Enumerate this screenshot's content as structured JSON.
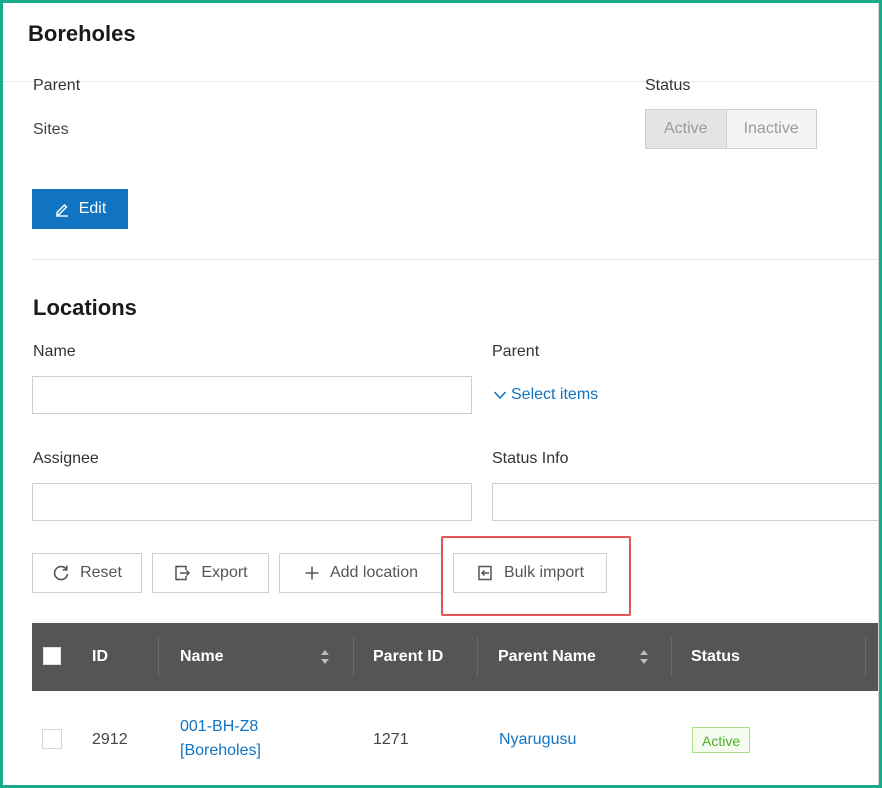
{
  "header": {
    "title": "Boreholes"
  },
  "details": {
    "parent_label": "Parent",
    "parent_value": "Sites",
    "status_label": "Status",
    "status_options": [
      "Active",
      "Inactive"
    ],
    "status_selected": "Active",
    "edit_label": "Edit"
  },
  "locations": {
    "title": "Locations",
    "filters": {
      "name_label": "Name",
      "name_value": "",
      "parent_label": "Parent",
      "parent_select_label": "Select items",
      "assignee_label": "Assignee",
      "assignee_value": "",
      "status_info_label": "Status Info",
      "status_info_value": ""
    },
    "toolbar": {
      "reset_label": "Reset",
      "export_label": "Export",
      "add_label": "Add location",
      "bulk_import_label": "Bulk import"
    },
    "table": {
      "columns": [
        "ID",
        "Name",
        "Parent ID",
        "Parent Name",
        "Status"
      ],
      "rows": [
        {
          "id": "2912",
          "name_line1": "001-BH-Z8",
          "name_line2": "[Boreholes]",
          "parent_id": "1271",
          "parent_name": "Nyarugusu",
          "status": "Active"
        }
      ]
    }
  },
  "colors": {
    "accent": "#1174c2",
    "frame": "#1aab8a",
    "highlight": "#e05555",
    "table_header": "#555555",
    "status_active": "#4caf2a"
  }
}
